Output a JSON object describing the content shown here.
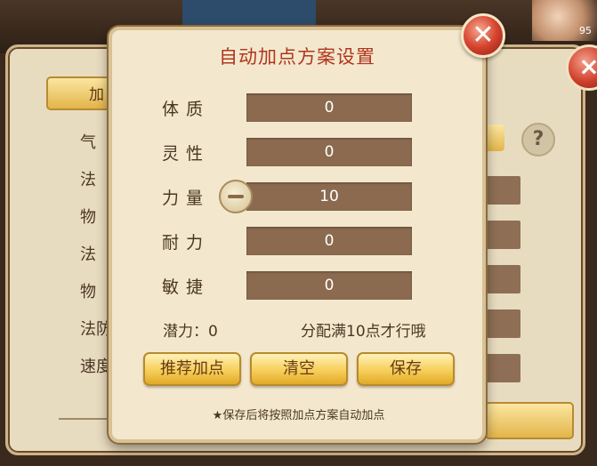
{
  "background": {
    "banner_text": "",
    "avatar_level": "95",
    "tab_label": "加",
    "stats": [
      "气",
      "法",
      "物",
      "法",
      "物",
      "法防",
      "速度"
    ],
    "help_glyph": "?",
    "bg_close_glyph": "×"
  },
  "dialog": {
    "title": "自动加点方案设置",
    "close_glyph": "✕",
    "rows": [
      {
        "label": "体质",
        "value": "0"
      },
      {
        "label": "灵性",
        "value": "0"
      },
      {
        "label": "力量",
        "value": "10"
      },
      {
        "label": "耐力",
        "value": "0"
      },
      {
        "label": "敏捷",
        "value": "0"
      }
    ],
    "potential_label": "潜力：0",
    "hint": "分配满10点才行哦",
    "buttons": {
      "recommend": "推荐加点",
      "clear": "清空",
      "save": "保存"
    },
    "footer_note": "★保存后将按照加点方案自动加点"
  },
  "colors": {
    "title": "#b0361e",
    "value_box": "#8b6a4f",
    "button_gold": "#f6cf5a",
    "close_red": "#d6442f"
  }
}
